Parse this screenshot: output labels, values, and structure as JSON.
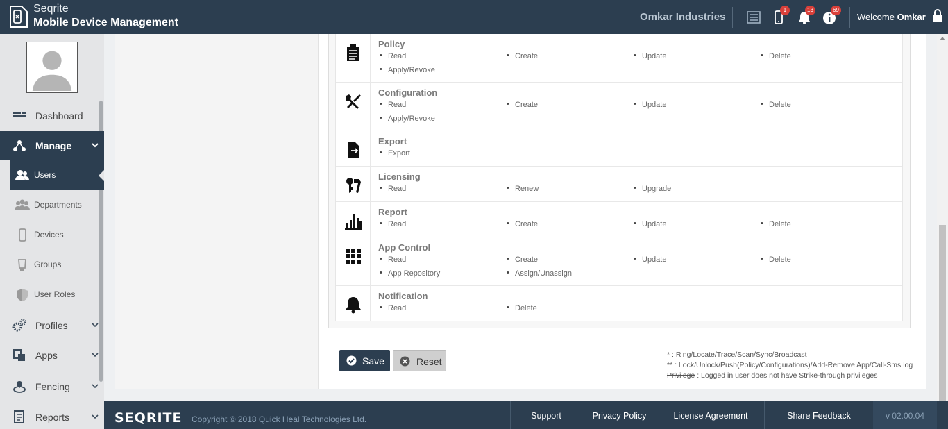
{
  "header": {
    "brand_line1": "Seqrite",
    "brand_line2": "Mobile Device Management",
    "organization": "Omkar Industries",
    "welcome_prefix": "Welcome",
    "welcome_user": "Omkar",
    "badges": {
      "devices": "1",
      "alerts": "13",
      "info": "69"
    }
  },
  "sidebar": {
    "items": [
      {
        "label": "Dashboard"
      },
      {
        "label": "Manage"
      },
      {
        "label": "Users"
      },
      {
        "label": "Departments"
      },
      {
        "label": "Devices"
      },
      {
        "label": "Groups"
      },
      {
        "label": "User Roles"
      },
      {
        "label": "Profiles"
      },
      {
        "label": "Apps"
      },
      {
        "label": "Fencing"
      },
      {
        "label": "Reports"
      }
    ]
  },
  "permissions": [
    {
      "title": "Policy",
      "icon": "clipboard-icon",
      "perms": [
        "Read",
        "Create",
        "Update",
        "Delete",
        "Apply/Revoke"
      ]
    },
    {
      "title": "Configuration",
      "icon": "tools-icon",
      "perms": [
        "Read",
        "Create",
        "Update",
        "Delete",
        "Apply/Revoke"
      ]
    },
    {
      "title": "Export",
      "icon": "export-icon",
      "perms": [
        "Export"
      ]
    },
    {
      "title": "Licensing",
      "icon": "key-icon",
      "perms": [
        "Read",
        "Renew",
        "Upgrade"
      ]
    },
    {
      "title": "Report",
      "icon": "bar-chart-icon",
      "perms": [
        "Read",
        "Create",
        "Update",
        "Delete"
      ]
    },
    {
      "title": "App Control",
      "icon": "grid-icon",
      "perms": [
        "Read",
        "Create",
        "Update",
        "Delete",
        "App Repository",
        "Assign/Unassign"
      ]
    },
    {
      "title": "Notification",
      "icon": "bell-icon",
      "perms": [
        "Read",
        "Delete"
      ]
    }
  ],
  "actions": {
    "save": "Save",
    "reset": "Reset"
  },
  "legend": {
    "line1": "* : Ring/Locate/Trace/Scan/Sync/Broadcast",
    "line2": "** : Lock/Unlock/Push(Policy/Configurations)/Add-Remove App/Call-Sms log",
    "line3_strike": "Privilege",
    "line3_text": " : Logged in user does not have Strike-through privileges"
  },
  "footer": {
    "logo": "SEQRITE",
    "copyright": "Copyright © 2018 Quick Heal Technologies Ltd.",
    "links": [
      "Support",
      "Privacy Policy",
      "License Agreement",
      "Share Feedback"
    ],
    "version": "v 02.00.04"
  },
  "colors": {
    "primary": "#2c3e50",
    "badge": "#d9403a"
  }
}
